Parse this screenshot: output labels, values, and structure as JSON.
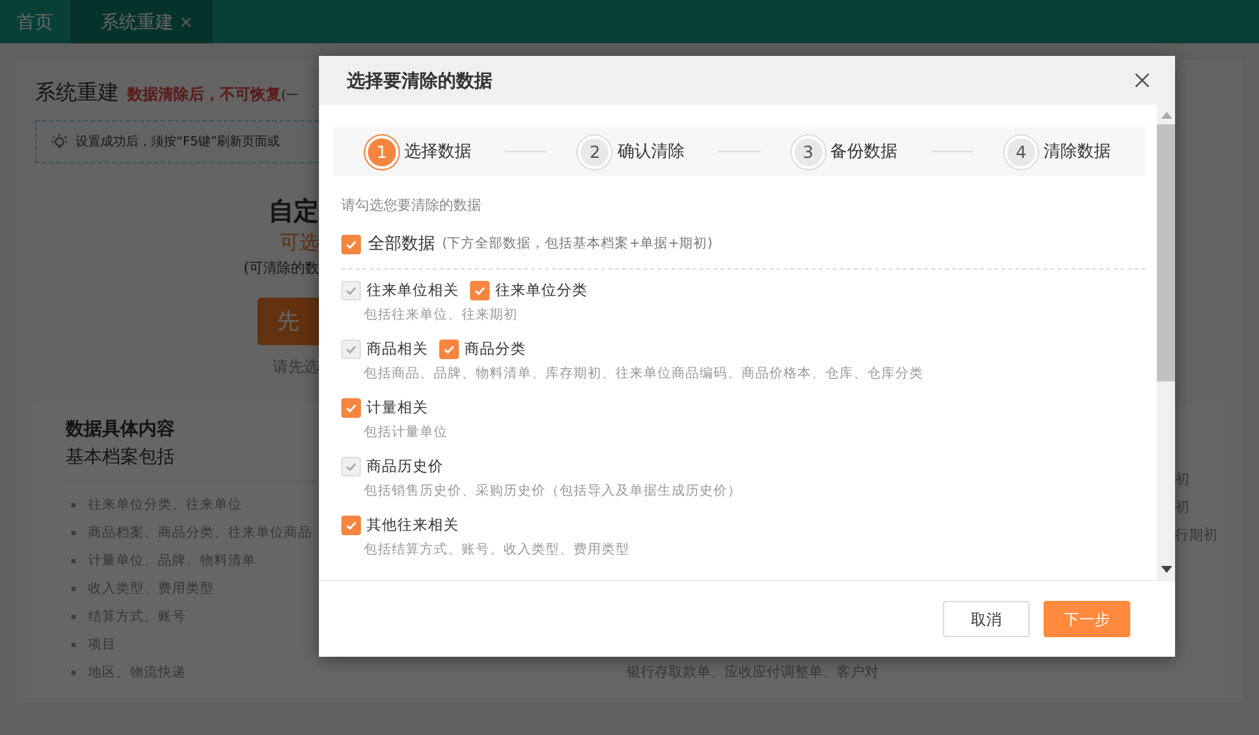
{
  "top_tabs": [
    {
      "label": "首页",
      "selected": false,
      "closable": false
    },
    {
      "label": "系统重建",
      "selected": true,
      "closable": true
    }
  ],
  "page": {
    "title": "系统重建",
    "warning": "数据清除后，不可恢复",
    "warning_note": "(一",
    "tip": "设置成功后，须按“F5键”刷新页面或",
    "custom_card": {
      "title": "自定",
      "subtitle": "可选",
      "note": "(可清除的数",
      "button": "先",
      "hint": "请先选"
    },
    "details": {
      "title": "数据具体内容",
      "subtitle": "基本档案包括",
      "items": [
        "往来单位分类、往来单位",
        "商品档案、商品分类、往来单位商品",
        "计量单位、品牌、物料清单",
        "收入类型、费用类型",
        "结算方式、账号",
        "项目",
        "地区、物流快递"
      ],
      "right_items": [
        "初",
        "初",
        "行期初"
      ],
      "footer_text": "银行存取款单、应收应付调整单、客户对"
    }
  },
  "dialog": {
    "title": "选择要清除的数据",
    "steps": [
      {
        "number": "1",
        "label": "选择数据",
        "selected": true
      },
      {
        "number": "2",
        "label": "确认清除",
        "selected": false
      },
      {
        "number": "3",
        "label": "备份数据",
        "selected": false
      },
      {
        "number": "4",
        "label": "清除数据",
        "selected": false
      }
    ],
    "hint": "请勾选您要清除的数据",
    "all_option": {
      "label": "全部数据",
      "checked": true,
      "note": "(下方全部数据，包括基本档案+单据+期初)"
    },
    "groups": [
      {
        "checkboxes": [
          {
            "label": "往来单位相关",
            "checked": true,
            "disabled": true
          },
          {
            "label": "往来单位分类",
            "checked": true,
            "disabled": false
          }
        ],
        "description": "包括往来单位、往来期初"
      },
      {
        "checkboxes": [
          {
            "label": "商品相关",
            "checked": true,
            "disabled": true
          },
          {
            "label": "商品分类",
            "checked": true,
            "disabled": false
          }
        ],
        "description": "包括商品、品牌、物料清单、库存期初、往来单位商品编码、商品价格本、仓库、仓库分类"
      },
      {
        "checkboxes": [
          {
            "label": "计量相关",
            "checked": true,
            "disabled": false
          }
        ],
        "description": "包括计量单位"
      },
      {
        "checkboxes": [
          {
            "label": "商品历史价",
            "checked": true,
            "disabled": true
          }
        ],
        "description": "包括销售历史价、采购历史价（包括导入及单据生成历史价）"
      },
      {
        "checkboxes": [
          {
            "label": "其他往来相关",
            "checked": true,
            "disabled": false
          }
        ],
        "description": "包括结算方式、账号、收入类型、费用类型"
      }
    ],
    "buttons": [
      {
        "label": "取消",
        "kind": "secondary"
      },
      {
        "label": "下一步",
        "kind": "primary"
      }
    ]
  }
}
